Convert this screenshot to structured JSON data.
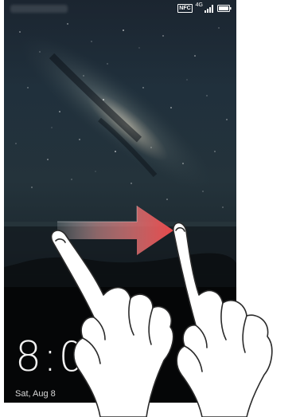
{
  "lock_screen": {
    "time": "8:08",
    "date": "Sat, Aug 8"
  },
  "status_bar": {
    "network": "4G",
    "nfc_label": "NFC",
    "icons": [
      "nfc-icon",
      "signal-icon",
      "battery-icon"
    ]
  },
  "gesture": {
    "direction": "right",
    "icons": [
      "swipe-arrow-icon",
      "hand-gesture-icon"
    ]
  },
  "colors": {
    "arrow": "#e8484a",
    "text": "#f2f2f2"
  }
}
